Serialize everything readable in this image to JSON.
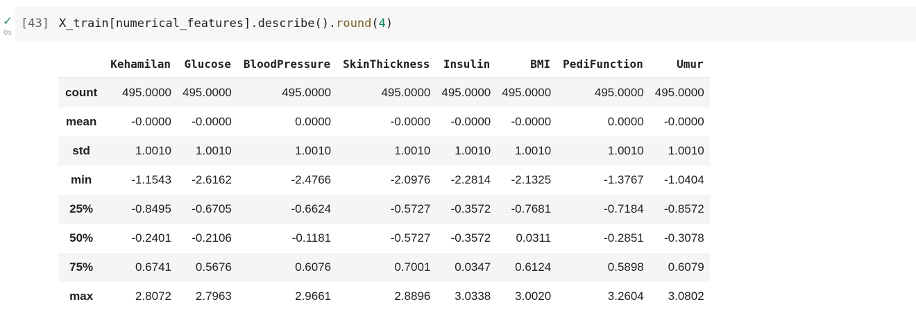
{
  "cell": {
    "exec_count": "[43]",
    "exec_time": "0s",
    "code": {
      "prefix": "X_train[numerical_features].describe().",
      "method": "round",
      "open": "(",
      "arg": "4",
      "close": ")"
    }
  },
  "output": {
    "columns": [
      "Kehamilan",
      "Glucose",
      "BloodPressure",
      "SkinThickness",
      "Insulin",
      "BMI",
      "PediFunction",
      "Umur"
    ],
    "rows": [
      {
        "label": "count",
        "values": [
          "495.0000",
          "495.0000",
          "495.0000",
          "495.0000",
          "495.0000",
          "495.0000",
          "495.0000",
          "495.0000"
        ]
      },
      {
        "label": "mean",
        "values": [
          "-0.0000",
          "-0.0000",
          "0.0000",
          "-0.0000",
          "-0.0000",
          "-0.0000",
          "0.0000",
          "-0.0000"
        ]
      },
      {
        "label": "std",
        "values": [
          "1.0010",
          "1.0010",
          "1.0010",
          "1.0010",
          "1.0010",
          "1.0010",
          "1.0010",
          "1.0010"
        ]
      },
      {
        "label": "min",
        "values": [
          "-1.1543",
          "-2.6162",
          "-2.4766",
          "-2.0976",
          "-2.2814",
          "-2.1325",
          "-1.3767",
          "-1.0404"
        ]
      },
      {
        "label": "25%",
        "values": [
          "-0.8495",
          "-0.6705",
          "-0.6624",
          "-0.5727",
          "-0.3572",
          "-0.7681",
          "-0.7184",
          "-0.8572"
        ]
      },
      {
        "label": "50%",
        "values": [
          "-0.2401",
          "-0.2106",
          "-0.1181",
          "-0.5727",
          "-0.3572",
          "0.0311",
          "-0.2851",
          "-0.3078"
        ]
      },
      {
        "label": "75%",
        "values": [
          "0.6741",
          "0.5676",
          "0.6076",
          "0.7001",
          "0.0347",
          "0.6124",
          "0.5898",
          "0.6079"
        ]
      },
      {
        "label": "max",
        "values": [
          "2.8072",
          "2.7963",
          "2.9661",
          "2.8896",
          "3.0338",
          "3.0020",
          "3.2604",
          "3.0802"
        ]
      }
    ]
  },
  "colors": {
    "check": "#2e8b57",
    "cell_bg": "#f7f7f7",
    "stripe": "#f5f5f5"
  }
}
